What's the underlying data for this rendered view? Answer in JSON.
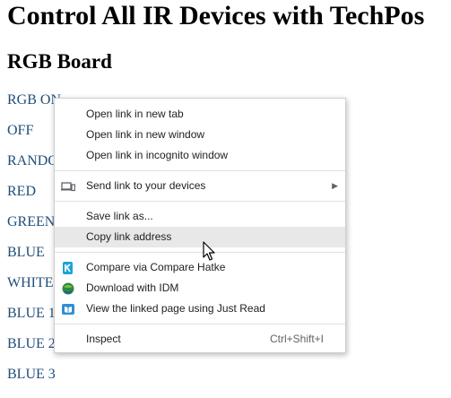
{
  "page": {
    "title": "Control All IR Devices with TechPos",
    "section_title": "RGB Board",
    "links": [
      "RGB ON",
      "OFF",
      "RANDO",
      "RED",
      "GREEN",
      "BLUE",
      "WHITE",
      "BLUE 1",
      "BLUE 2",
      "BLUE 3"
    ]
  },
  "context_menu": {
    "group1": [
      "Open link in new tab",
      "Open link in new window",
      "Open link in incognito window"
    ],
    "send_to_devices": "Send link to your devices",
    "group3": [
      "Save link as...",
      "Copy link address"
    ],
    "highlighted_item": "Copy link address",
    "extensions": [
      {
        "label": "Compare via Compare Hatke",
        "icon": "compare-hatke-icon"
      },
      {
        "label": "Download with IDM",
        "icon": "idm-icon"
      },
      {
        "label": "View the linked page using Just Read",
        "icon": "just-read-icon"
      }
    ],
    "inspect": {
      "label": "Inspect",
      "shortcut": "Ctrl+Shift+I"
    }
  },
  "colors": {
    "link": "#1f4e79",
    "menu_highlight": "#e8e8e8"
  }
}
